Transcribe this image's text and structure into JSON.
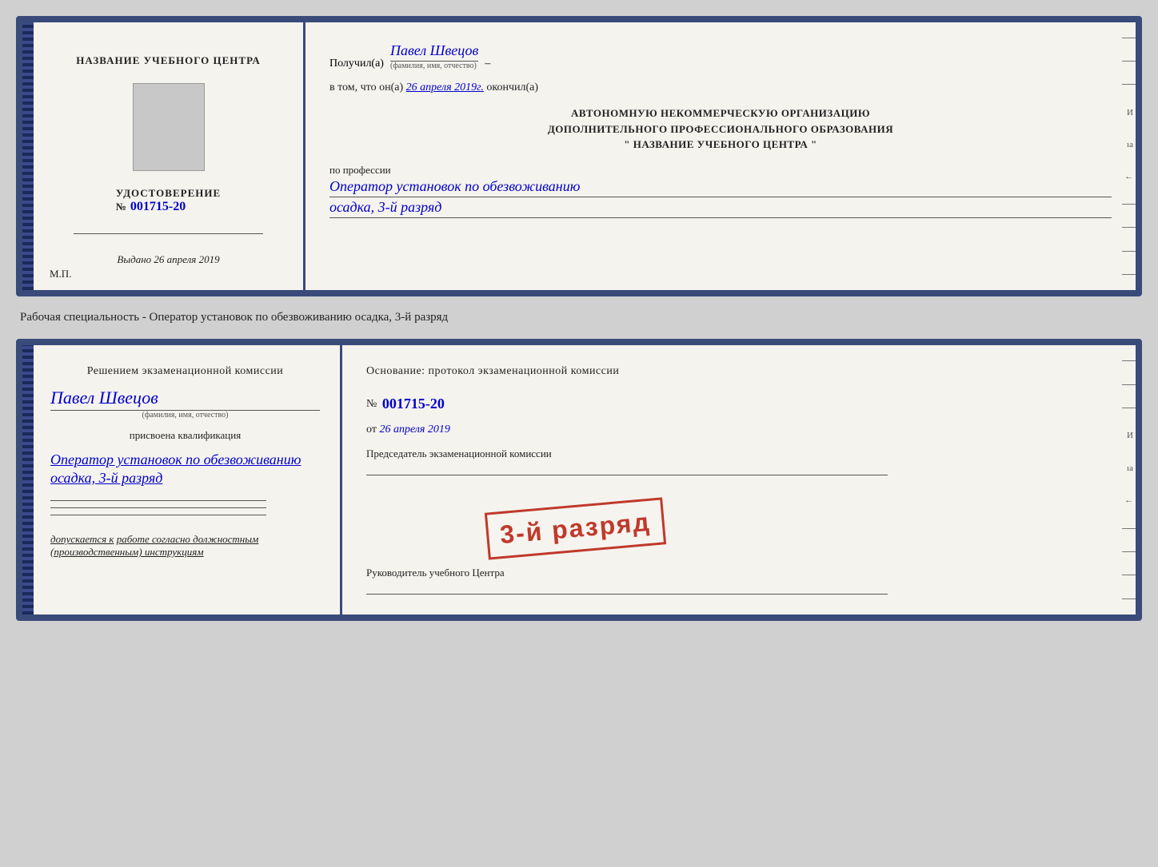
{
  "doc1": {
    "left": {
      "title": "НАЗВАНИЕ УЧЕБНОГО ЦЕНТРА",
      "cert_label": "УДОСТОВЕРЕНИЕ",
      "cert_number_prefix": "№",
      "cert_number": "001715-20",
      "issued_label": "Выдано",
      "issued_date": "26 апреля 2019",
      "mp_label": "М.П."
    },
    "right": {
      "received_label": "Получил(а)",
      "recipient_name": "Павел Швецов",
      "recipient_subtext": "(фамилия, имя, отчество)",
      "dash": "–",
      "confirm_prefix": "в том, что он(а)",
      "confirm_date": "26 апреля 2019г.",
      "confirm_suffix": "окончил(а)",
      "org_line1": "АВТОНОМНУЮ НЕКОММЕРЧЕСКУЮ ОРГАНИЗАЦИЮ",
      "org_line2": "ДОПОЛНИТЕЛЬНОГО ПРОФЕССИОНАЛЬНОГО ОБРАЗОВАНИЯ",
      "org_line3": "\"  НАЗВАНИЕ УЧЕБНОГО ЦЕНТРА  \"",
      "profession_label": "по профессии",
      "profession_value": "Оператор установок по обезвоживанию",
      "rank_value": "осадка, 3-й разряд"
    }
  },
  "specialty_text": "Рабочая специальность - Оператор установок по обезвоживанию осадка, 3-й разряд",
  "doc2": {
    "left": {
      "commission_title": "Решением экзаменационной комиссии",
      "person_name": "Павел Швецов",
      "person_subtext": "(фамилия, имя, отчество)",
      "qualification_label": "присвоена квалификация",
      "qualification_value": "Оператор установок по обезвоживанию",
      "rank_value": "осадка, 3-й разряд",
      "допускается_prefix": "допускается к",
      "допускается_value": "работе согласно должностным (производственным) инструкциям"
    },
    "right": {
      "basis_label": "Основание: протокол экзаменационной комиссии",
      "protocol_number_prefix": "№",
      "protocol_number": "001715-20",
      "date_prefix": "от",
      "protocol_date": "26 апреля 2019",
      "chairman_label": "Председатель экзаменационной комиссии",
      "director_label": "Руководитель учебного Центра"
    },
    "stamp": {
      "line1": "3-й разряд"
    }
  },
  "right_edge_marks": [
    "–",
    "–",
    "–",
    "И",
    "ıа",
    "←",
    "–",
    "–",
    "–",
    "–"
  ]
}
